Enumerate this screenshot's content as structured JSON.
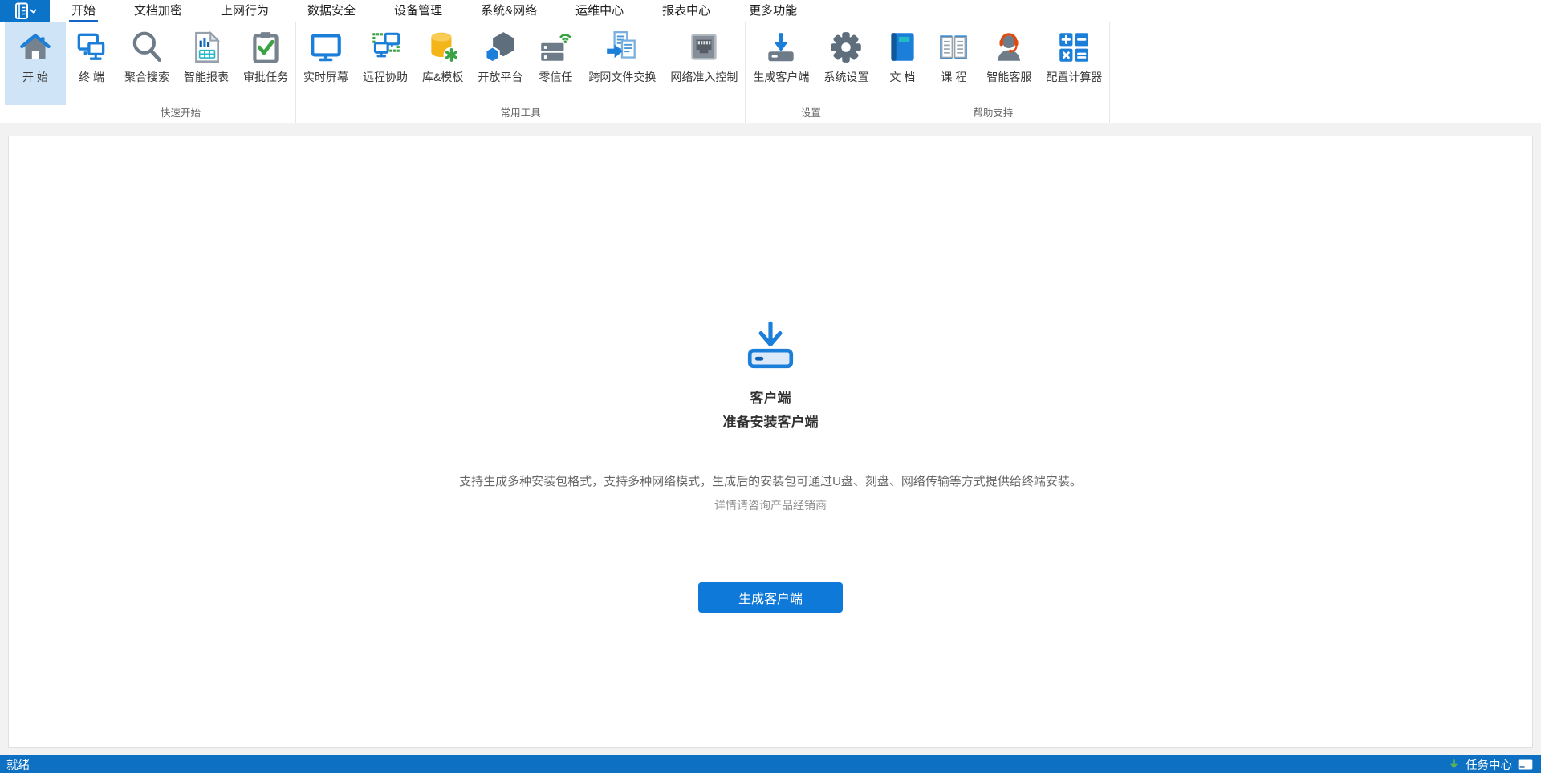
{
  "colors": {
    "accent_blue": "#1b7ed9",
    "app_button_blue": "#0b74c9",
    "statusbar_blue": "#0d70c2",
    "selected_item_bg": "#cfe4f7",
    "active_tab_underline": "#1565c8",
    "primary_button_blue": "#0e79d8",
    "status_green": "#57b25e"
  },
  "menu": {
    "app_button_icon": "app-menu-icon",
    "tabs": [
      {
        "label": "开始",
        "active": true
      },
      {
        "label": "文档加密",
        "active": false
      },
      {
        "label": "上网行为",
        "active": false
      },
      {
        "label": "数据安全",
        "active": false
      },
      {
        "label": "设备管理",
        "active": false
      },
      {
        "label": "系统&网络",
        "active": false
      },
      {
        "label": "运维中心",
        "active": false
      },
      {
        "label": "报表中心",
        "active": false
      },
      {
        "label": "更多功能",
        "active": false
      }
    ]
  },
  "ribbon": {
    "home": {
      "label": "开 始",
      "icon": "home-icon",
      "selected": true
    },
    "groups": [
      {
        "label": "快速开始",
        "items": [
          {
            "label": "终 端",
            "icon": "terminal-icon"
          },
          {
            "label": "聚合搜索",
            "icon": "search-icon"
          },
          {
            "label": "智能报表",
            "icon": "report-icon"
          },
          {
            "label": "审批任务",
            "icon": "approve-icon"
          }
        ]
      },
      {
        "label": "常用工具",
        "items": [
          {
            "label": "实时屏幕",
            "icon": "screen-icon"
          },
          {
            "label": "远程协助",
            "icon": "remote-icon"
          },
          {
            "label": "库&模板",
            "icon": "library-icon"
          },
          {
            "label": "开放平台",
            "icon": "platform-icon"
          },
          {
            "label": "零信任",
            "icon": "zerotrust-icon"
          },
          {
            "label": "跨网文件交换",
            "icon": "exchange-icon"
          },
          {
            "label": "网络准入控制",
            "icon": "nac-icon"
          }
        ]
      },
      {
        "label": "设置",
        "items": [
          {
            "label": "生成客户端",
            "icon": "genclient-icon"
          },
          {
            "label": "系统设置",
            "icon": "settings-icon"
          }
        ]
      },
      {
        "label": "帮助支持",
        "items": [
          {
            "label": "文 档",
            "icon": "doc-icon"
          },
          {
            "label": "课 程",
            "icon": "course-icon"
          },
          {
            "label": "智能客服",
            "icon": "service-icon"
          },
          {
            "label": "配置计算器",
            "icon": "calc-icon"
          }
        ]
      }
    ]
  },
  "main": {
    "icon": "download-icon",
    "title": "客户端",
    "subtitle": "准备安装客户端",
    "description": "支持生成多种安装包格式，支持多种网络模式，生成后的安装包可通过U盘、刻盘、网络传输等方式提供给终端安装。",
    "note": "详情请咨询产品经销商",
    "button_label": "生成客户端"
  },
  "statusbar": {
    "ready": "就绪",
    "task_center": "任务中心",
    "download_icon": "status-arrow-icon",
    "monitor_icon": "status-monitor-icon"
  }
}
